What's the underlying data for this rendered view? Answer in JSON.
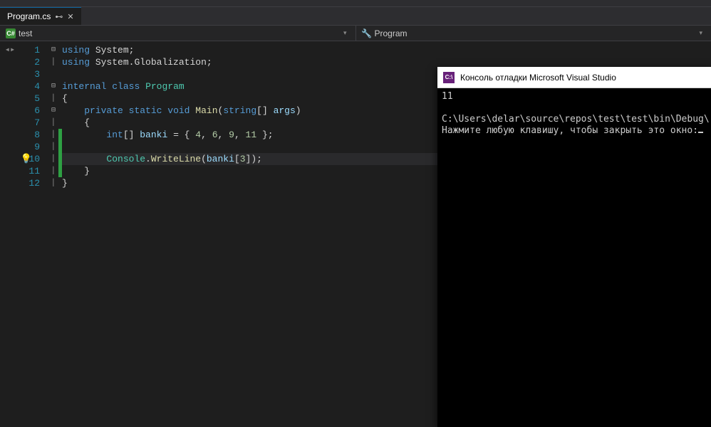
{
  "tab": {
    "title": "Program.cs",
    "pin_tooltip": "Toggle pin status",
    "close_tooltip": "Close"
  },
  "breadcrumb": {
    "project_label": "test",
    "class_label": "Program"
  },
  "editor": {
    "line_numbers": [
      "1",
      "2",
      "3",
      "4",
      "5",
      "6",
      "7",
      "8",
      "9",
      "10",
      "11",
      "12"
    ],
    "code": {
      "l1": {
        "kw1": "using",
        "ns": "System",
        "semi": ";"
      },
      "l2": {
        "kw1": "using",
        "ns1": "System",
        "dot": ".",
        "ns2": "Globalization",
        "semi": ";"
      },
      "l4": {
        "kw1": "internal",
        "kw2": "class",
        "name": "Program"
      },
      "l5": {
        "brace": "{"
      },
      "l6": {
        "kw1": "private",
        "kw2": "static",
        "kw3": "void",
        "name": "Main",
        "lp": "(",
        "type": "string",
        "arr": "[]",
        "param": "args",
        "rp": ")"
      },
      "l7": {
        "brace": "{"
      },
      "l8": {
        "type": "int",
        "arr": "[]",
        "name": "banki",
        "eq": " = ",
        "lb": "{ ",
        "n1": "4",
        "c": ", ",
        "n2": "6",
        "n3": "9",
        "n4": "11",
        "rb": " }",
        "semi": ";"
      },
      "l10": {
        "cls": "Console",
        "dot": ".",
        "mth": "WriteLine",
        "lp": "(",
        "var": "banki",
        "lb": "[",
        "idx": "3",
        "rb": "]",
        "rp": ")",
        "semi": ";"
      },
      "l11": {
        "brace": "}"
      },
      "l12": {
        "brace": "}"
      }
    }
  },
  "console": {
    "title": "Консоль отладки Microsoft Visual Studio",
    "output_value": "11",
    "path_line": "C:\\Users\\delar\\source\\repos\\test\\test\\bin\\Debug\\",
    "prompt_line": "Нажмите любую клавишу, чтобы закрыть это окно:"
  }
}
